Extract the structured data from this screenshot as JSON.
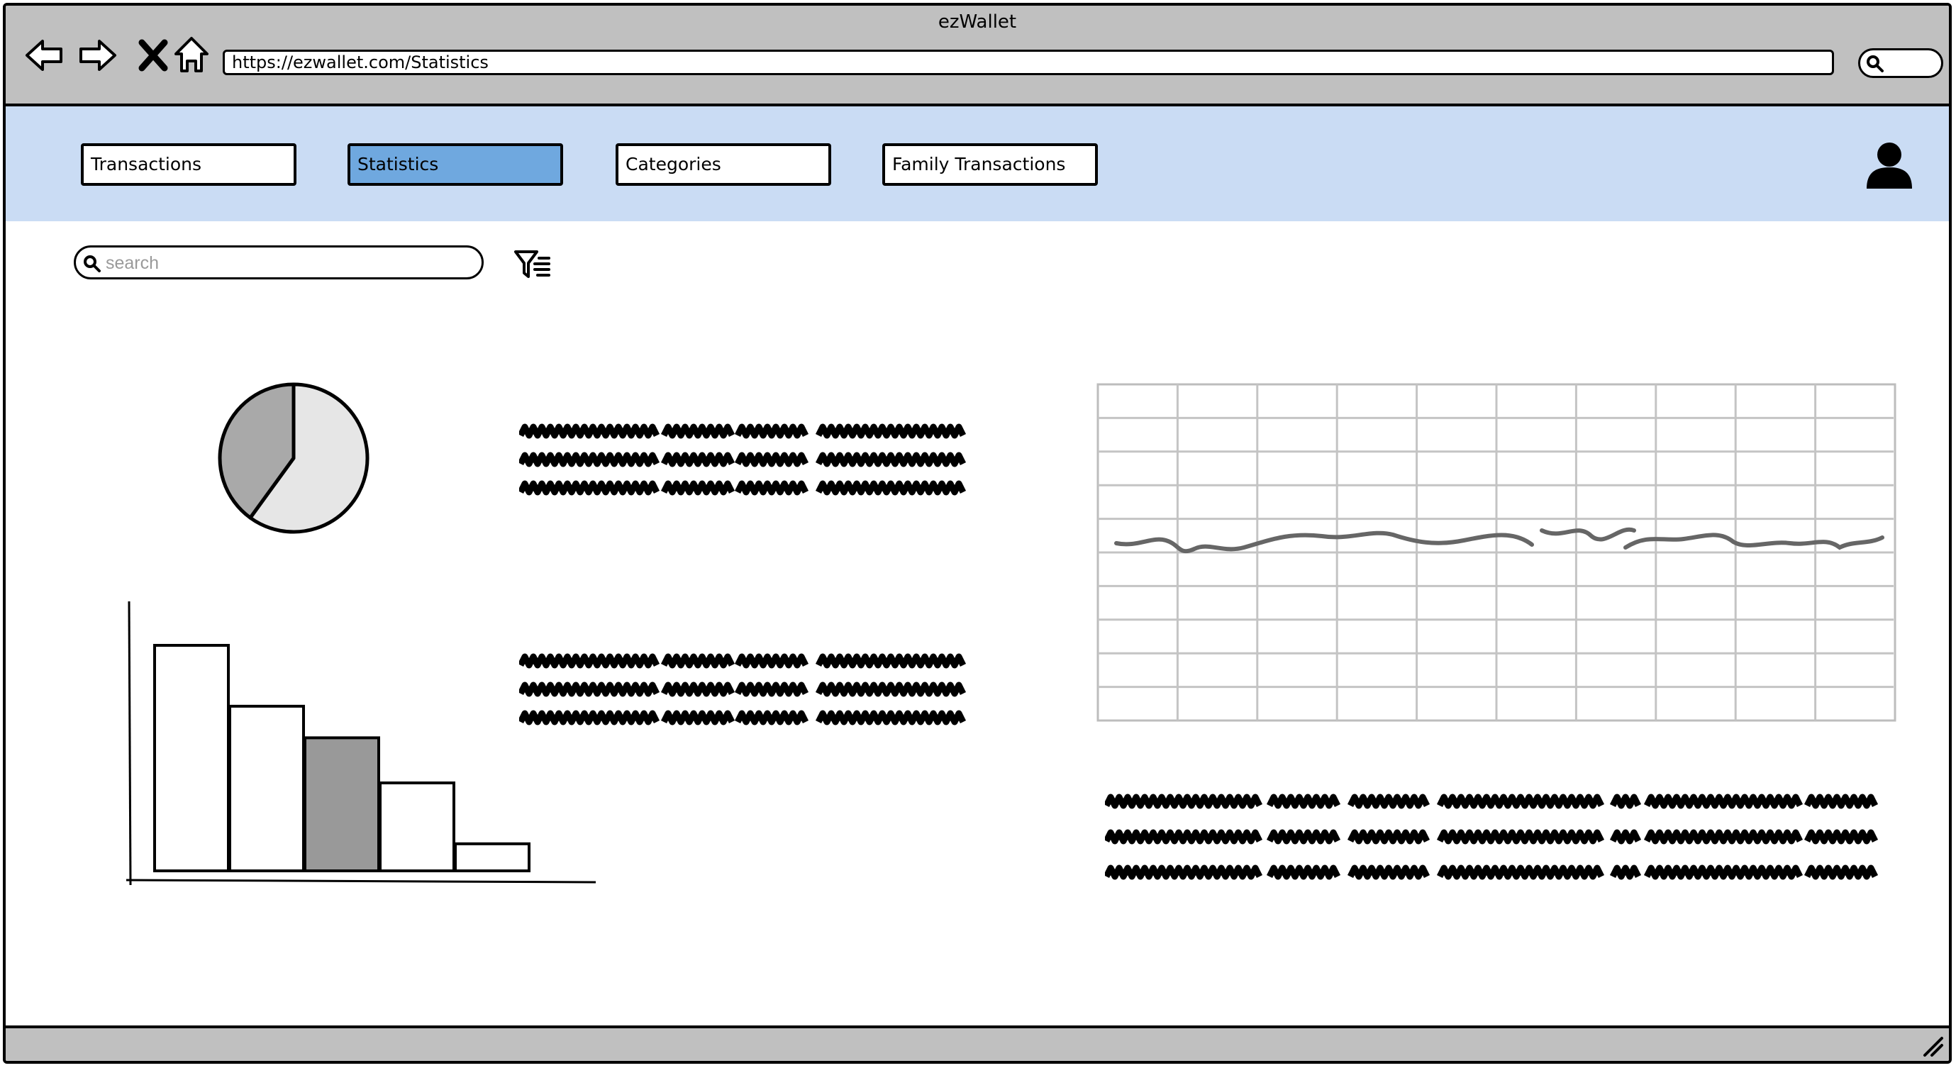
{
  "window": {
    "title": "ezWallet"
  },
  "browser": {
    "url": "https://ezwallet.com/Statistics",
    "icons": [
      "back-arrow-icon",
      "forward-arrow-icon",
      "close-icon",
      "home-icon",
      "search-icon"
    ]
  },
  "nav": {
    "items": [
      {
        "label": "Transactions",
        "active": false
      },
      {
        "label": "Statistics",
        "active": true
      },
      {
        "label": "Categories",
        "active": false
      },
      {
        "label": "Family Transactions",
        "active": false
      }
    ],
    "avatar_icon": "user-avatar-icon",
    "active_color": "#6fa8df",
    "header_color": "#cadcf4"
  },
  "toolbar": {
    "search_placeholder": "search",
    "filter_icon": "filter-list-icon"
  },
  "chart_data": [
    {
      "type": "pie",
      "values": [
        0.6,
        0.4
      ],
      "colors": [
        "#e6e6e6",
        "#a9a9a9"
      ]
    },
    {
      "type": "bar",
      "values": [
        100,
        73,
        59,
        39,
        12
      ],
      "highlight_index": 2,
      "colors": {
        "bar": "#ffffff",
        "highlight": "#999999"
      }
    },
    {
      "type": "line",
      "grid": true,
      "series_color": "#666666"
    }
  ]
}
